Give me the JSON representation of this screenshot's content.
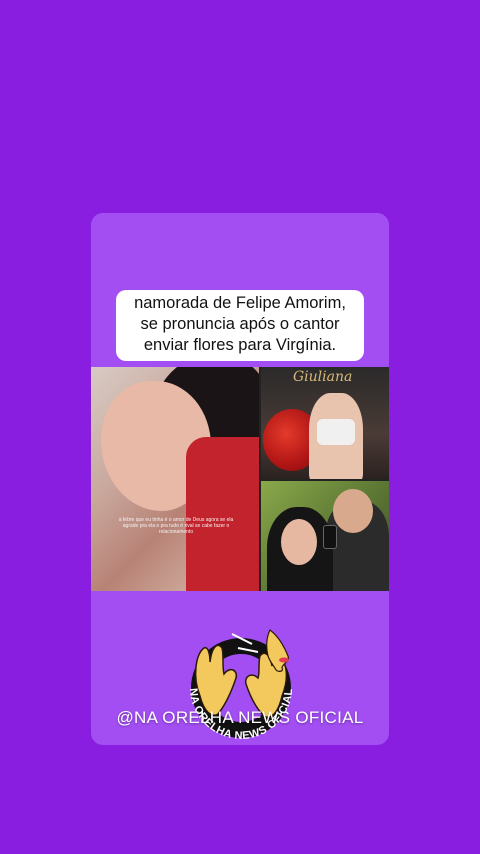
{
  "headline": {
    "line1": "namorada de Felipe Amorim,",
    "line2": "se pronuncia após o cantor",
    "line3": "enviar flores para Virgínia."
  },
  "photos": {
    "left_caption": "a febre que eu tinha é o amor de Deus agora se ela agrade pra ela e pra tudo é rival se cabe fazer o relacionamento",
    "top_right_sign": "Giuliana"
  },
  "footer": {
    "handle": "@NA ORELHA NEWS OFICIAL",
    "logo_text": "NA ORELHA NEWS OFICIAL"
  },
  "colors": {
    "background": "#8a1ee0",
    "card": "#a24ef2",
    "logo_ring": "#111111",
    "logo_hand": "#f3c95e",
    "logo_text": "#ffffff"
  }
}
